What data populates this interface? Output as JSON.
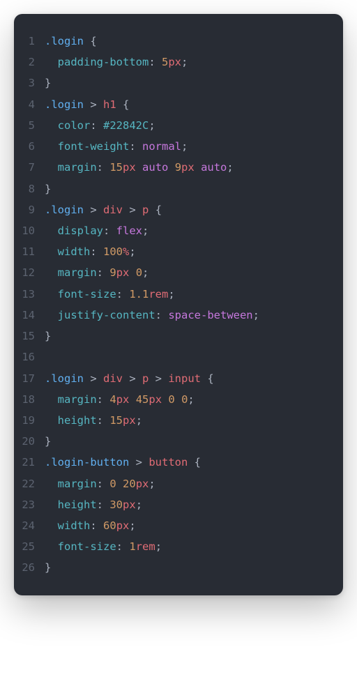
{
  "code": {
    "lines": [
      {
        "num": "1",
        "tokens": [
          {
            "t": "selector-class",
            "v": ".login"
          },
          {
            "t": "plain",
            "v": " "
          },
          {
            "t": "brace",
            "v": "{"
          }
        ]
      },
      {
        "num": "2",
        "tokens": [
          {
            "t": "plain",
            "v": "  "
          },
          {
            "t": "property",
            "v": "padding-bottom"
          },
          {
            "t": "colon",
            "v": ": "
          },
          {
            "t": "value-num",
            "v": "5"
          },
          {
            "t": "value-unit",
            "v": "px"
          },
          {
            "t": "semicolon",
            "v": ";"
          }
        ]
      },
      {
        "num": "3",
        "tokens": [
          {
            "t": "brace",
            "v": "}"
          }
        ]
      },
      {
        "num": "4",
        "tokens": [
          {
            "t": "selector-class",
            "v": ".login"
          },
          {
            "t": "selector-combinator",
            "v": " > "
          },
          {
            "t": "selector-tag",
            "v": "h1"
          },
          {
            "t": "plain",
            "v": " "
          },
          {
            "t": "brace",
            "v": "{"
          }
        ]
      },
      {
        "num": "5",
        "tokens": [
          {
            "t": "plain",
            "v": "  "
          },
          {
            "t": "property",
            "v": "color"
          },
          {
            "t": "colon",
            "v": ": "
          },
          {
            "t": "value-hex",
            "v": "#22842C"
          },
          {
            "t": "semicolon",
            "v": ";"
          }
        ]
      },
      {
        "num": "6",
        "tokens": [
          {
            "t": "plain",
            "v": "  "
          },
          {
            "t": "property",
            "v": "font-weight"
          },
          {
            "t": "colon",
            "v": ": "
          },
          {
            "t": "value-auto",
            "v": "normal"
          },
          {
            "t": "semicolon",
            "v": ";"
          }
        ]
      },
      {
        "num": "7",
        "tokens": [
          {
            "t": "plain",
            "v": "  "
          },
          {
            "t": "property",
            "v": "margin"
          },
          {
            "t": "colon",
            "v": ": "
          },
          {
            "t": "value-num",
            "v": "15"
          },
          {
            "t": "value-unit",
            "v": "px"
          },
          {
            "t": "plain",
            "v": " "
          },
          {
            "t": "value-auto",
            "v": "auto"
          },
          {
            "t": "plain",
            "v": " "
          },
          {
            "t": "value-num",
            "v": "9"
          },
          {
            "t": "value-unit",
            "v": "px"
          },
          {
            "t": "plain",
            "v": " "
          },
          {
            "t": "value-auto",
            "v": "auto"
          },
          {
            "t": "semicolon",
            "v": ";"
          }
        ]
      },
      {
        "num": "8",
        "tokens": [
          {
            "t": "brace",
            "v": "}"
          }
        ]
      },
      {
        "num": "9",
        "tokens": [
          {
            "t": "selector-class",
            "v": ".login"
          },
          {
            "t": "selector-combinator",
            "v": " > "
          },
          {
            "t": "selector-tag",
            "v": "div"
          },
          {
            "t": "selector-combinator",
            "v": " > "
          },
          {
            "t": "selector-tag",
            "v": "p"
          },
          {
            "t": "plain",
            "v": " "
          },
          {
            "t": "brace",
            "v": "{"
          }
        ]
      },
      {
        "num": "10",
        "tokens": [
          {
            "t": "plain",
            "v": "  "
          },
          {
            "t": "property",
            "v": "display"
          },
          {
            "t": "colon",
            "v": ": "
          },
          {
            "t": "value-flex",
            "v": "flex"
          },
          {
            "t": "semicolon",
            "v": ";"
          }
        ]
      },
      {
        "num": "11",
        "tokens": [
          {
            "t": "plain",
            "v": "  "
          },
          {
            "t": "property",
            "v": "width"
          },
          {
            "t": "colon",
            "v": ": "
          },
          {
            "t": "value-num",
            "v": "100"
          },
          {
            "t": "value-unit",
            "v": "%"
          },
          {
            "t": "semicolon",
            "v": ";"
          }
        ]
      },
      {
        "num": "12",
        "tokens": [
          {
            "t": "plain",
            "v": "  "
          },
          {
            "t": "property",
            "v": "margin"
          },
          {
            "t": "colon",
            "v": ": "
          },
          {
            "t": "value-num",
            "v": "9"
          },
          {
            "t": "value-unit",
            "v": "px"
          },
          {
            "t": "plain",
            "v": " "
          },
          {
            "t": "value-num",
            "v": "0"
          },
          {
            "t": "semicolon",
            "v": ";"
          }
        ]
      },
      {
        "num": "13",
        "tokens": [
          {
            "t": "plain",
            "v": "  "
          },
          {
            "t": "property",
            "v": "font-size"
          },
          {
            "t": "colon",
            "v": ": "
          },
          {
            "t": "value-num",
            "v": "1.1"
          },
          {
            "t": "value-unit",
            "v": "rem"
          },
          {
            "t": "semicolon",
            "v": ";"
          }
        ]
      },
      {
        "num": "14",
        "tokens": [
          {
            "t": "plain",
            "v": "  "
          },
          {
            "t": "property",
            "v": "justify-content"
          },
          {
            "t": "colon",
            "v": ": "
          },
          {
            "t": "value-sb",
            "v": "space-between"
          },
          {
            "t": "semicolon",
            "v": ";"
          }
        ]
      },
      {
        "num": "15",
        "tokens": [
          {
            "t": "brace",
            "v": "}"
          }
        ]
      },
      {
        "num": "16",
        "tokens": []
      },
      {
        "num": "17",
        "tokens": [
          {
            "t": "selector-class",
            "v": ".login"
          },
          {
            "t": "selector-combinator",
            "v": " > "
          },
          {
            "t": "selector-tag",
            "v": "div"
          },
          {
            "t": "selector-combinator",
            "v": " > "
          },
          {
            "t": "selector-tag",
            "v": "p"
          },
          {
            "t": "selector-combinator",
            "v": " > "
          },
          {
            "t": "selector-tag",
            "v": "input"
          },
          {
            "t": "plain",
            "v": " "
          },
          {
            "t": "brace",
            "v": "{"
          }
        ]
      },
      {
        "num": "18",
        "tokens": [
          {
            "t": "plain",
            "v": "  "
          },
          {
            "t": "property",
            "v": "margin"
          },
          {
            "t": "colon",
            "v": ": "
          },
          {
            "t": "value-num",
            "v": "4"
          },
          {
            "t": "value-unit",
            "v": "px"
          },
          {
            "t": "plain",
            "v": " "
          },
          {
            "t": "value-num",
            "v": "45"
          },
          {
            "t": "value-unit",
            "v": "px"
          },
          {
            "t": "plain",
            "v": " "
          },
          {
            "t": "value-num",
            "v": "0"
          },
          {
            "t": "plain",
            "v": " "
          },
          {
            "t": "value-num",
            "v": "0"
          },
          {
            "t": "semicolon",
            "v": ";"
          }
        ]
      },
      {
        "num": "19",
        "tokens": [
          {
            "t": "plain",
            "v": "  "
          },
          {
            "t": "property",
            "v": "height"
          },
          {
            "t": "colon",
            "v": ": "
          },
          {
            "t": "value-num",
            "v": "15"
          },
          {
            "t": "value-unit",
            "v": "px"
          },
          {
            "t": "semicolon",
            "v": ";"
          }
        ]
      },
      {
        "num": "20",
        "tokens": [
          {
            "t": "brace",
            "v": "}"
          }
        ]
      },
      {
        "num": "21",
        "tokens": [
          {
            "t": "selector-class",
            "v": ".login-button"
          },
          {
            "t": "selector-combinator",
            "v": " > "
          },
          {
            "t": "selector-tag",
            "v": "button"
          },
          {
            "t": "plain",
            "v": " "
          },
          {
            "t": "brace",
            "v": "{"
          }
        ]
      },
      {
        "num": "22",
        "tokens": [
          {
            "t": "plain",
            "v": "  "
          },
          {
            "t": "property",
            "v": "margin"
          },
          {
            "t": "colon",
            "v": ": "
          },
          {
            "t": "value-num",
            "v": "0"
          },
          {
            "t": "plain",
            "v": " "
          },
          {
            "t": "value-num",
            "v": "20"
          },
          {
            "t": "value-unit",
            "v": "px"
          },
          {
            "t": "semicolon",
            "v": ";"
          }
        ]
      },
      {
        "num": "23",
        "tokens": [
          {
            "t": "plain",
            "v": "  "
          },
          {
            "t": "property",
            "v": "height"
          },
          {
            "t": "colon",
            "v": ": "
          },
          {
            "t": "value-num",
            "v": "30"
          },
          {
            "t": "value-unit",
            "v": "px"
          },
          {
            "t": "semicolon",
            "v": ";"
          }
        ]
      },
      {
        "num": "24",
        "tokens": [
          {
            "t": "plain",
            "v": "  "
          },
          {
            "t": "property",
            "v": "width"
          },
          {
            "t": "colon",
            "v": ": "
          },
          {
            "t": "value-num",
            "v": "60"
          },
          {
            "t": "value-unit",
            "v": "px"
          },
          {
            "t": "semicolon",
            "v": ";"
          }
        ]
      },
      {
        "num": "25",
        "tokens": [
          {
            "t": "plain",
            "v": "  "
          },
          {
            "t": "property",
            "v": "font-size"
          },
          {
            "t": "colon",
            "v": ": "
          },
          {
            "t": "value-num",
            "v": "1"
          },
          {
            "t": "value-unit",
            "v": "rem"
          },
          {
            "t": "semicolon",
            "v": ";"
          }
        ]
      },
      {
        "num": "26",
        "tokens": [
          {
            "t": "brace",
            "v": "}"
          }
        ]
      }
    ]
  }
}
